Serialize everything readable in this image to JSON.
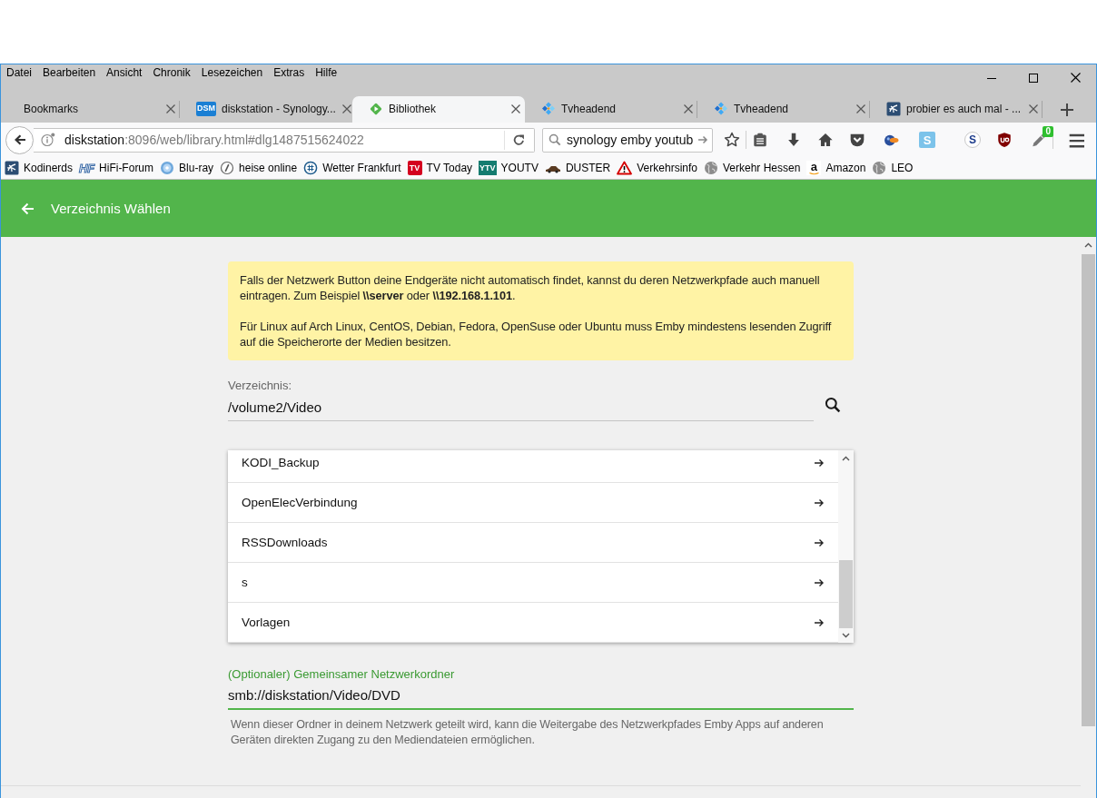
{
  "menu_bar": {
    "items": [
      "Datei",
      "Bearbeiten",
      "Ansicht",
      "Chronik",
      "Lesezeichen",
      "Extras",
      "Hilfe"
    ]
  },
  "tabs": [
    {
      "title": "Bookmarks",
      "selected": false
    },
    {
      "title": "diskstation - Synology...",
      "selected": false,
      "logo_text": "DSM"
    },
    {
      "title": "Bibliothek",
      "selected": true
    },
    {
      "title": "Tvheadend",
      "selected": false
    },
    {
      "title": "Tvheadend",
      "selected": false
    },
    {
      "title": "probier es auch mal - ...",
      "selected": false
    }
  ],
  "address_bar": {
    "host": "diskstation",
    "rest": ":8096/web/library.html#dlg1487515624022"
  },
  "search_bar": {
    "value": "synology emby youtub"
  },
  "toolbar": {
    "addon_logo_texts": [
      "S",
      "S"
    ],
    "addon_badge": "0"
  },
  "bookmarks": [
    {
      "label": "Kodinerds"
    },
    {
      "label": "HiFi-Forum",
      "logo_text": "HF"
    },
    {
      "label": "Blu-ray"
    },
    {
      "label": "heise online"
    },
    {
      "label": "Wetter Frankfurt"
    },
    {
      "label": "TV Today",
      "logo_text": "TV"
    },
    {
      "label": "YOUTV",
      "logo_text": "YTV"
    },
    {
      "label": "DUSTER"
    },
    {
      "label": "Verkehrsinfo"
    },
    {
      "label": "Verkehr Hessen"
    },
    {
      "label": "Amazon",
      "logo_text": "a"
    },
    {
      "label": "LEO"
    }
  ],
  "header": {
    "title": "Verzeichnis Wählen"
  },
  "notice": {
    "paragraphs": [
      "Falls der Netzwerk Button deine Endgeräte nicht automatisch findet, kannst du deren Netzwerkpfade auch manuell eintragen. Zum Beispiel **\\\\server** oder **\\\\192.168.1.101**.",
      "Für Linux auf Arch Linux, CentOS, Debian, Fedora, OpenSuse oder Ubuntu muss Emby mindestens lesenden Zugriff auf die Speicherorte der Medien besitzen."
    ]
  },
  "directory_field": {
    "label": "Verzeichnis:",
    "value": "/volume2/Video",
    "focused": false
  },
  "folders": [
    "KODI_Backup",
    "OpenElecVerbindung",
    "RSSDownloads",
    "s",
    "Vorlagen"
  ],
  "network_share_field": {
    "label": "(Optionaler) Gemeinsamer Netzwerkordner",
    "value": "smb://diskstation/Video/DVD",
    "focused": true,
    "description": "Wenn dieser Ordner in deinem Netzwerk geteilt wird, kann die Weitergabe des Netzwerkpfades Emby Apps auf anderen Geräten direkten Zugang zu den Mediendateien ermöglichen."
  }
}
